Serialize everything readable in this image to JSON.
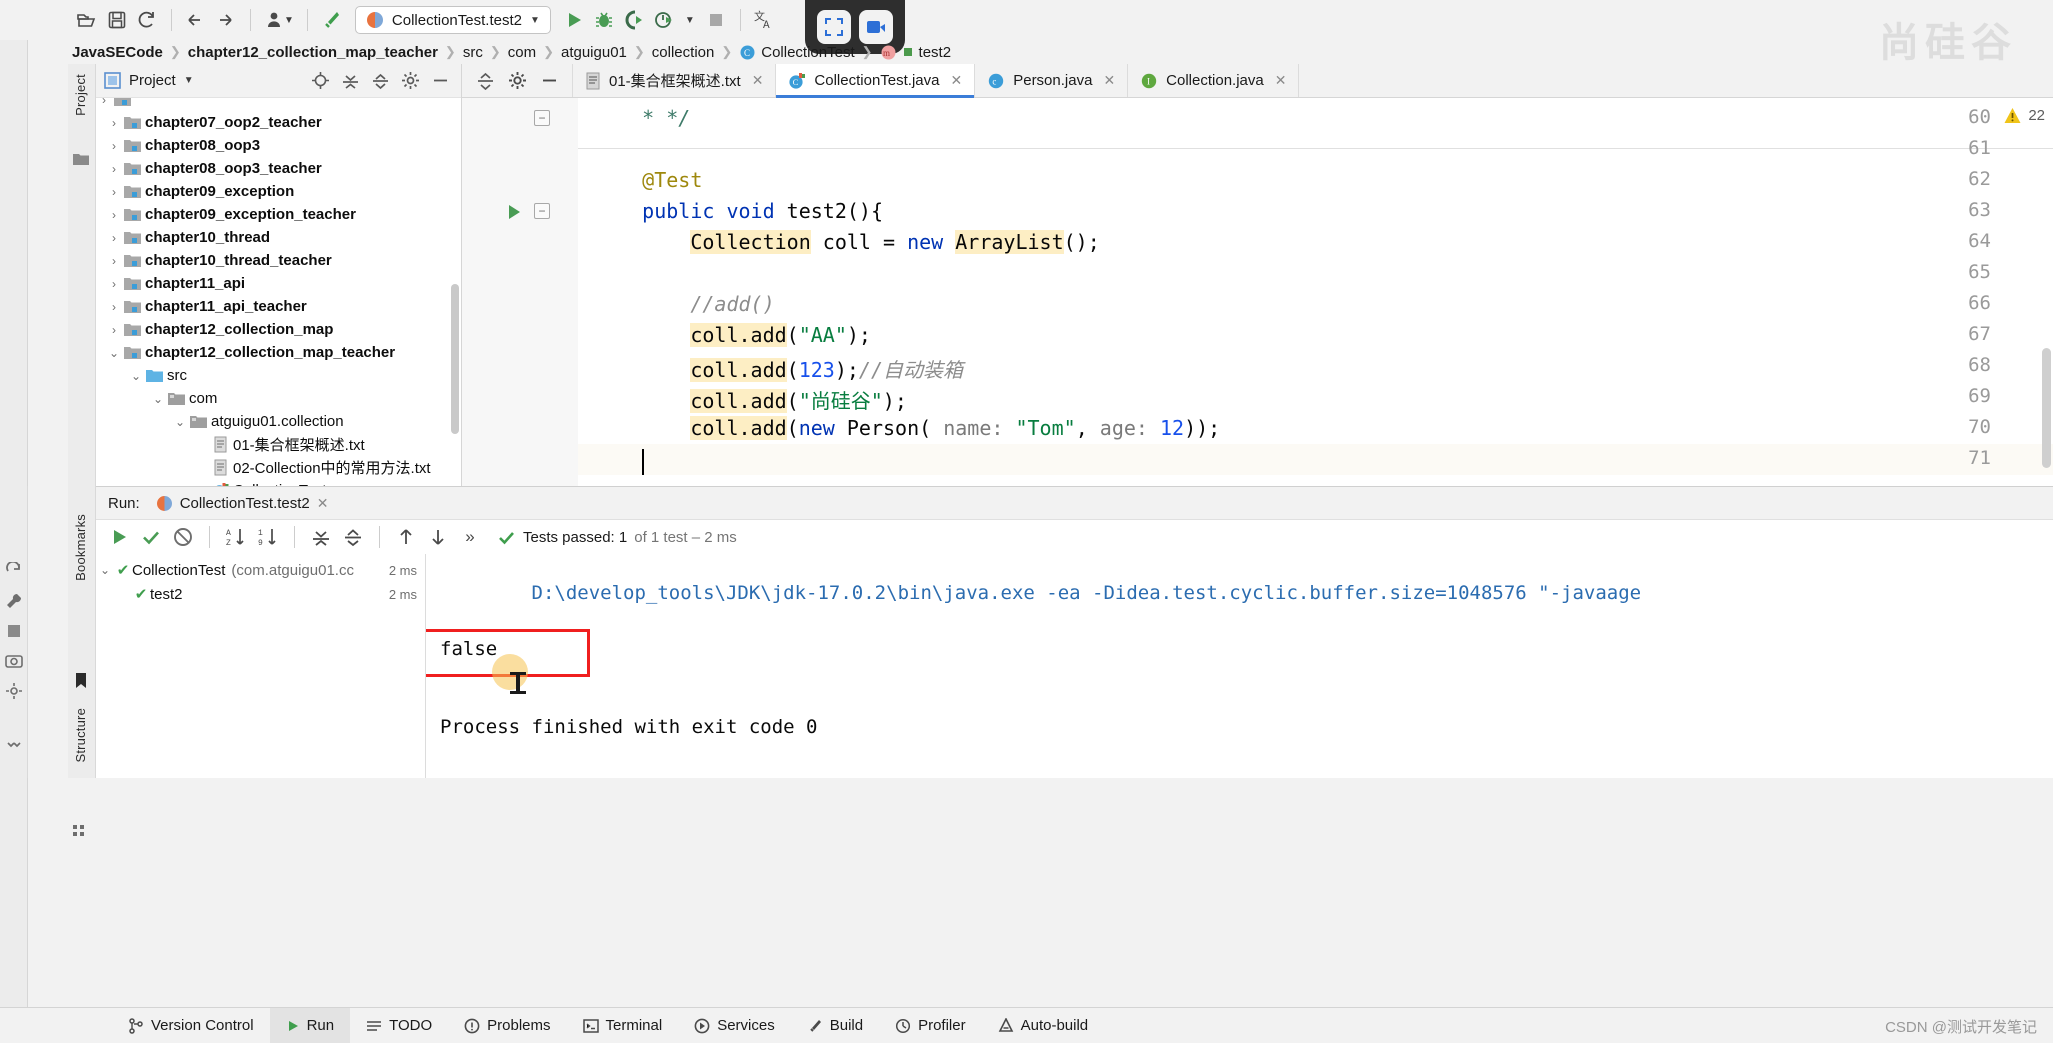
{
  "toolbar": {
    "buttons": [
      {
        "name": "open-folder-icon",
        "glyph": "folder"
      },
      {
        "name": "save-all-icon",
        "glyph": "save"
      },
      {
        "name": "sync-icon",
        "glyph": "sync"
      },
      {
        "name": "back-icon",
        "glyph": "arrow-left"
      },
      {
        "name": "forward-icon",
        "glyph": "arrow-right"
      },
      {
        "name": "user-icon",
        "glyph": "user"
      },
      {
        "name": "hammer-icon",
        "glyph": "hammer"
      }
    ],
    "run_config": "CollectionTest.test2",
    "run_label": "Run",
    "debug_label": "Debug",
    "coverage_label": "Run with Coverage",
    "profile_label": "Profile",
    "stop_label": "Stop",
    "translate_label": "Translate"
  },
  "breadcrumb": [
    {
      "label": "JavaSECode",
      "bold": true,
      "icon": ""
    },
    {
      "label": "chapter12_collection_map_teacher",
      "bold": true,
      "icon": ""
    },
    {
      "label": "src",
      "bold": false,
      "icon": ""
    },
    {
      "label": "com",
      "bold": false,
      "icon": ""
    },
    {
      "label": "atguigu01",
      "bold": false,
      "icon": ""
    },
    {
      "label": "collection",
      "bold": false,
      "icon": ""
    },
    {
      "label": "CollectionTest",
      "bold": false,
      "icon": "class-icon"
    },
    {
      "label": "test2",
      "bold": false,
      "icon": "method-icon"
    }
  ],
  "left_rail": {
    "project_tab": "Project",
    "bookmarks_tab": "Bookmarks",
    "structure_tab": "Structure"
  },
  "project_panel": {
    "title": "Project",
    "tools": [
      "locate-icon",
      "expand-all-icon",
      "collapse-all-icon",
      "settings-icon",
      "hide-icon"
    ],
    "tree": [
      {
        "label": "chapter07_oop2_teacher",
        "indent": 1,
        "arrow": "collapsed",
        "icon": "module-icon",
        "bold": true
      },
      {
        "label": "chapter08_oop3",
        "indent": 1,
        "arrow": "collapsed",
        "icon": "module-icon",
        "bold": true
      },
      {
        "label": "chapter08_oop3_teacher",
        "indent": 1,
        "arrow": "collapsed",
        "icon": "module-icon",
        "bold": true
      },
      {
        "label": "chapter09_exception",
        "indent": 1,
        "arrow": "collapsed",
        "icon": "module-icon",
        "bold": true
      },
      {
        "label": "chapter09_exception_teacher",
        "indent": 1,
        "arrow": "collapsed",
        "icon": "module-icon",
        "bold": true
      },
      {
        "label": "chapter10_thread",
        "indent": 1,
        "arrow": "collapsed",
        "icon": "module-icon",
        "bold": true
      },
      {
        "label": "chapter10_thread_teacher",
        "indent": 1,
        "arrow": "collapsed",
        "icon": "module-icon",
        "bold": true
      },
      {
        "label": "chapter11_api",
        "indent": 1,
        "arrow": "collapsed",
        "icon": "module-icon",
        "bold": true
      },
      {
        "label": "chapter11_api_teacher",
        "indent": 1,
        "arrow": "collapsed",
        "icon": "module-icon",
        "bold": true
      },
      {
        "label": "chapter12_collection_map",
        "indent": 1,
        "arrow": "collapsed",
        "icon": "module-icon",
        "bold": true
      },
      {
        "label": "chapter12_collection_map_teacher",
        "indent": 1,
        "arrow": "expanded",
        "icon": "module-icon",
        "bold": true
      },
      {
        "label": "src",
        "indent": 2,
        "arrow": "expanded",
        "icon": "source-folder-icon",
        "bold": false
      },
      {
        "label": "com",
        "indent": 3,
        "arrow": "expanded",
        "icon": "package-icon",
        "bold": false
      },
      {
        "label": "atguigu01.collection",
        "indent": 4,
        "arrow": "expanded",
        "icon": "package-icon",
        "bold": false
      },
      {
        "label": "01-集合框架概述.txt",
        "indent": 5,
        "arrow": "none",
        "icon": "text-file-icon",
        "bold": false
      },
      {
        "label": "02-Collection中的常用方法.txt",
        "indent": 5,
        "arrow": "none",
        "icon": "text-file-icon",
        "bold": false
      },
      {
        "label": "CollectionTest",
        "indent": 5,
        "arrow": "none",
        "icon": "test-class-icon",
        "bold": false
      }
    ]
  },
  "editor_tabs": [
    {
      "label": "01-集合框架概述.txt",
      "icon": "text-file-icon",
      "active": false
    },
    {
      "label": "CollectionTest.java",
      "icon": "test-class-icon",
      "active": true
    },
    {
      "label": "Person.java",
      "icon": "class-icon",
      "active": false
    },
    {
      "label": "Collection.java",
      "icon": "interface-icon",
      "active": false
    }
  ],
  "editor": {
    "warning_count": "22",
    "first_line_number": 60,
    "lines": [
      {
        "n": 60,
        "tokens": [
          {
            "t": "    * */",
            "c": "dc"
          }
        ],
        "fold": "end"
      },
      {
        "n": 61,
        "tokens": [
          {
            "t": "",
            "c": ""
          }
        ]
      },
      {
        "n": 62,
        "tokens": [
          {
            "t": "    ",
            "c": ""
          },
          {
            "t": "@Test",
            "c": "an"
          }
        ]
      },
      {
        "n": 63,
        "tokens": [
          {
            "t": "    ",
            "c": ""
          },
          {
            "t": "public",
            "c": "k"
          },
          {
            "t": " ",
            "c": ""
          },
          {
            "t": "void",
            "c": "k"
          },
          {
            "t": " test2(){",
            "c": ""
          }
        ],
        "fold": "start",
        "gutter_run": true
      },
      {
        "n": 64,
        "tokens": [
          {
            "t": "        ",
            "c": ""
          },
          {
            "t": "Collection",
            "c": "hl"
          },
          {
            "t": " coll = ",
            "c": ""
          },
          {
            "t": "new",
            "c": "k"
          },
          {
            "t": " ",
            "c": ""
          },
          {
            "t": "ArrayList",
            "c": "hl"
          },
          {
            "t": "();",
            "c": ""
          }
        ]
      },
      {
        "n": 65,
        "tokens": [
          {
            "t": "",
            "c": ""
          }
        ]
      },
      {
        "n": 66,
        "tokens": [
          {
            "t": "        ",
            "c": ""
          },
          {
            "t": "//add()",
            "c": "cm"
          }
        ]
      },
      {
        "n": 67,
        "tokens": [
          {
            "t": "        ",
            "c": ""
          },
          {
            "t": "coll.add",
            "c": "hl"
          },
          {
            "t": "(",
            "c": ""
          },
          {
            "t": "\"AA\"",
            "c": "st"
          },
          {
            "t": ");",
            "c": ""
          }
        ]
      },
      {
        "n": 68,
        "tokens": [
          {
            "t": "        ",
            "c": ""
          },
          {
            "t": "coll.add",
            "c": "hl"
          },
          {
            "t": "(",
            "c": ""
          },
          {
            "t": "123",
            "c": "nu"
          },
          {
            "t": ");",
            "c": ""
          },
          {
            "t": "//自动装箱",
            "c": "cm"
          }
        ]
      },
      {
        "n": 69,
        "tokens": [
          {
            "t": "        ",
            "c": ""
          },
          {
            "t": "coll.add",
            "c": "hl"
          },
          {
            "t": "(",
            "c": ""
          },
          {
            "t": "\"尚硅谷\"",
            "c": "st"
          },
          {
            "t": ");",
            "c": ""
          }
        ]
      },
      {
        "n": 70,
        "tokens": [
          {
            "t": "        ",
            "c": ""
          },
          {
            "t": "coll.add",
            "c": "hl"
          },
          {
            "t": "(",
            "c": ""
          },
          {
            "t": "new",
            "c": "k"
          },
          {
            "t": " Person( ",
            "c": ""
          },
          {
            "t": "name:",
            "c": "pn"
          },
          {
            "t": " ",
            "c": ""
          },
          {
            "t": "\"Tom\"",
            "c": "st"
          },
          {
            "t": ", ",
            "c": ""
          },
          {
            "t": "age:",
            "c": "pn"
          },
          {
            "t": " ",
            "c": ""
          },
          {
            "t": "12",
            "c": "nu"
          },
          {
            "t": "));",
            "c": ""
          }
        ]
      },
      {
        "n": 71,
        "tokens": [
          {
            "t": "",
            "c": ""
          }
        ],
        "caret": true
      }
    ]
  },
  "run_window": {
    "title": "Run:",
    "tab_label": "CollectionTest.test2",
    "toolbar_buttons": [
      "rerun-icon",
      "show-passed-icon",
      "hide-ignored-icon",
      "sort-alphabetically-icon",
      "sort-by-duration-icon",
      "expand-all-icon",
      "collapse-all-icon",
      "prev-failed-icon",
      "next-failed-icon",
      "more-icon"
    ],
    "status_main": "Tests passed: 1",
    "status_rest": "of 1 test – 2 ms",
    "tests": [
      {
        "label": "CollectionTest",
        "sub": "(com.atguigu01.cc",
        "duration": "2 ms",
        "indent": 0,
        "arrow": "expanded"
      },
      {
        "label": "test2",
        "sub": "",
        "duration": "2 ms",
        "indent": 1,
        "arrow": "none"
      }
    ],
    "console": [
      "D:\\develop_tools\\JDK\\jdk-17.0.2\\bin\\java.exe -ea -Didea.test.cyclic.buffer.size=1048576 \"-javaage",
      "false",
      "",
      "Process finished with exit code 0"
    ],
    "console_highlight": "false"
  },
  "status_bar": [
    {
      "label": "Version Control",
      "icon": "branch-icon",
      "active": false
    },
    {
      "label": "Run",
      "icon": "run-icon",
      "active": true
    },
    {
      "label": "TODO",
      "icon": "todo-icon",
      "active": false
    },
    {
      "label": "Problems",
      "icon": "problems-icon",
      "active": false
    },
    {
      "label": "Terminal",
      "icon": "terminal-icon",
      "active": false
    },
    {
      "label": "Services",
      "icon": "services-icon",
      "active": false
    },
    {
      "label": "Build",
      "icon": "build-icon",
      "active": false
    },
    {
      "label": "Profiler",
      "icon": "profiler-icon",
      "active": false
    },
    {
      "label": "Auto-build",
      "icon": "auto-build-icon",
      "active": false
    }
  ],
  "watermark": "CSDN @测试开发笔记",
  "brand_watermark": "尚硅谷",
  "colors": {
    "accent_blue": "#3b7dd8",
    "run_green": "#499c54",
    "error_red": "#f01f1f",
    "highlight_yellow": "#fdeec4",
    "panel_gray": "#f2f2f2"
  }
}
